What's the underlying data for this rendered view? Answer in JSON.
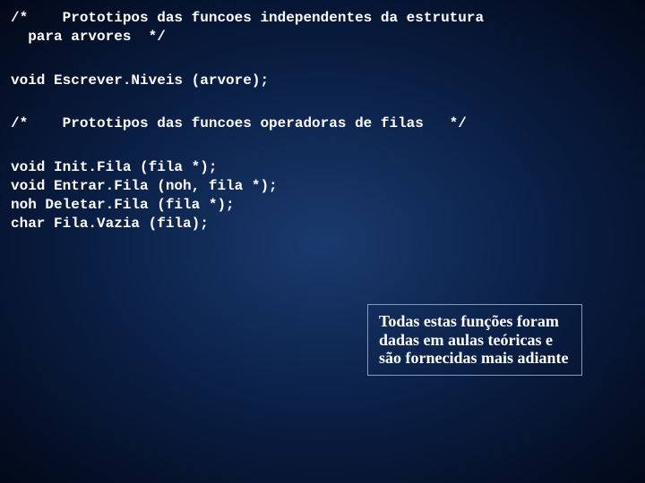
{
  "code": {
    "comment1": "/*    Prototipos das funcoes independentes da estrutura\n  para arvores  */",
    "line1": "void Escrever.Niveis (arvore);",
    "comment2": "/*    Prototipos das funcoes operadoras de filas   */",
    "lines2": "void Init.Fila (fila *);\nvoid Entrar.Fila (noh, fila *);\nnoh Deletar.Fila (fila *);\nchar Fila.Vazia (fila);"
  },
  "note": "Todas estas funções foram dadas em aulas teóricas e são fornecidas mais adiante"
}
